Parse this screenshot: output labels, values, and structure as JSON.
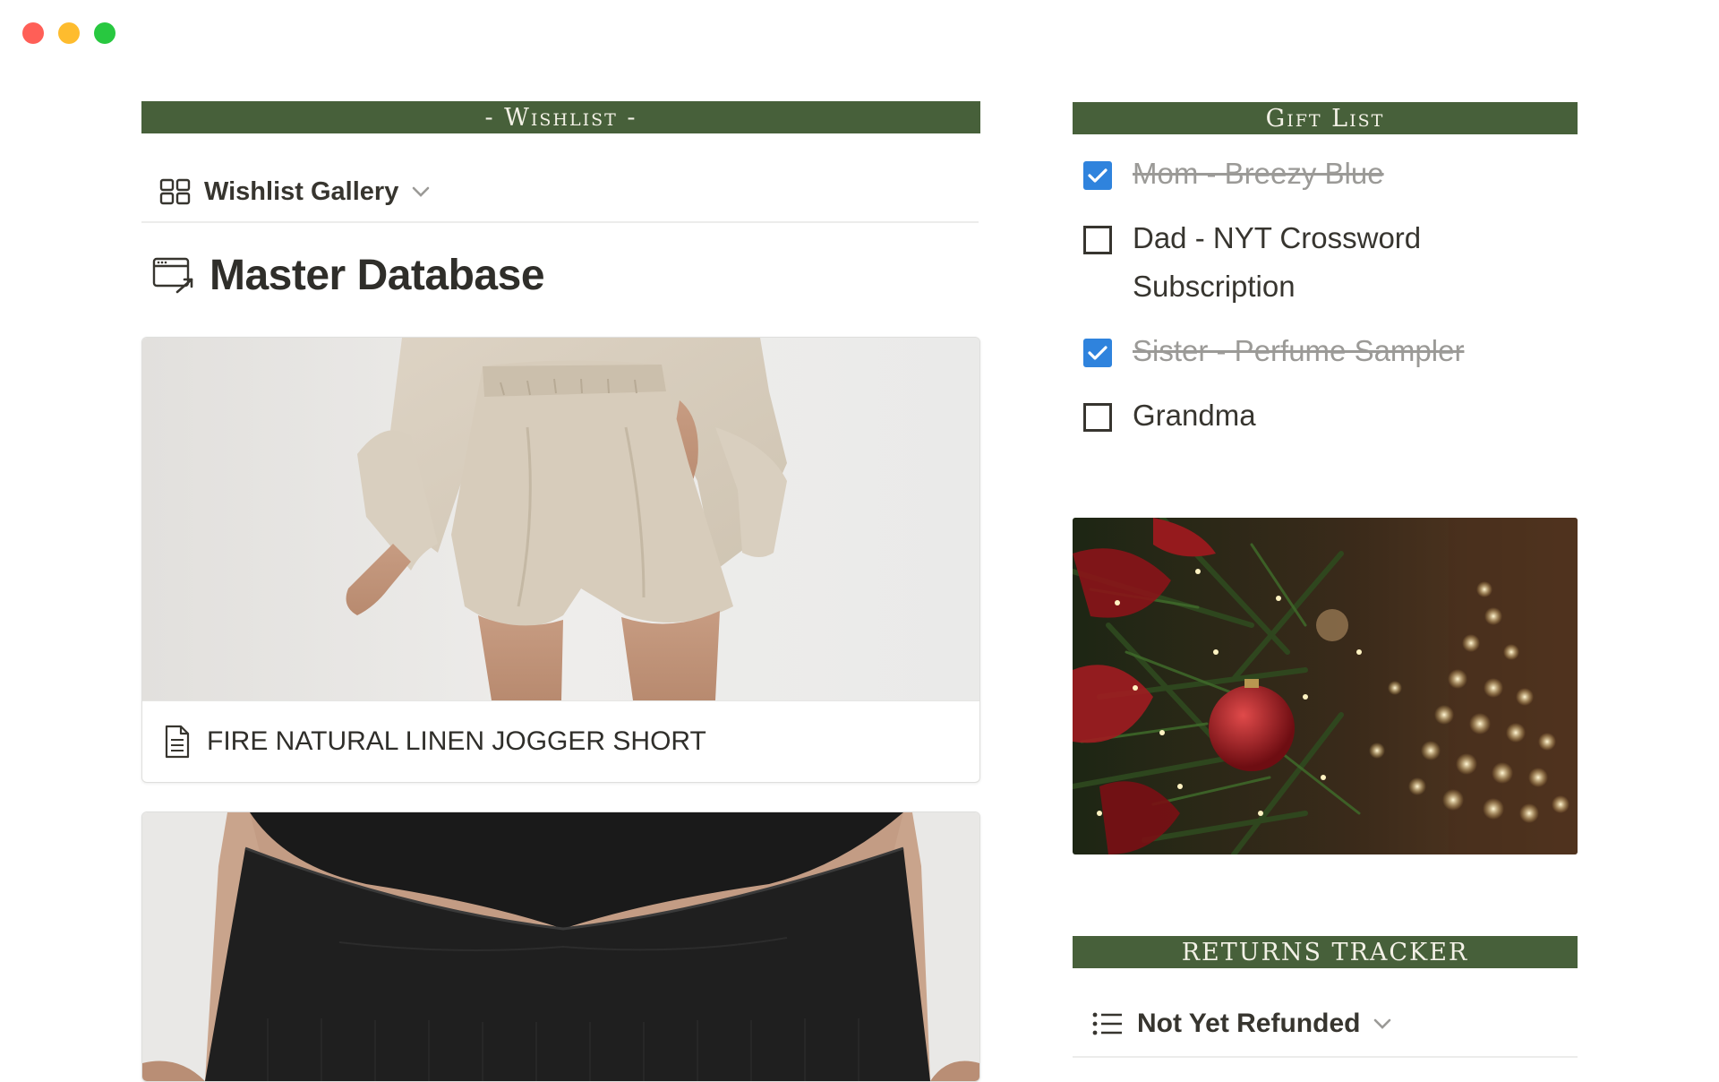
{
  "window": {
    "controls": {
      "close_color": "#ff5f57",
      "minimize_color": "#febc2e",
      "zoom_color": "#28c840"
    }
  },
  "wishlist": {
    "banner": "- Wishlist -",
    "view_name": "Wishlist Gallery",
    "database_title": "Master Database",
    "cards": [
      {
        "title": "FIRE NATURAL LINEN JOGGER SHORT"
      },
      {
        "title": ""
      }
    ]
  },
  "gift_list": {
    "banner": "Gift List",
    "items": [
      {
        "text": "Mom - Breezy Blue",
        "checked": true
      },
      {
        "text": "Dad - NYT Crossword Subscription",
        "checked": false
      },
      {
        "text": "Sister - Perfume Sampler",
        "checked": true
      },
      {
        "text": "Grandma",
        "checked": false
      }
    ]
  },
  "returns": {
    "banner": "RETURNS TRACKER",
    "view_name": "Not Yet Refunded"
  },
  "colors": {
    "banner_green": "#47603a",
    "checkbox_blue": "#2f83dd"
  }
}
